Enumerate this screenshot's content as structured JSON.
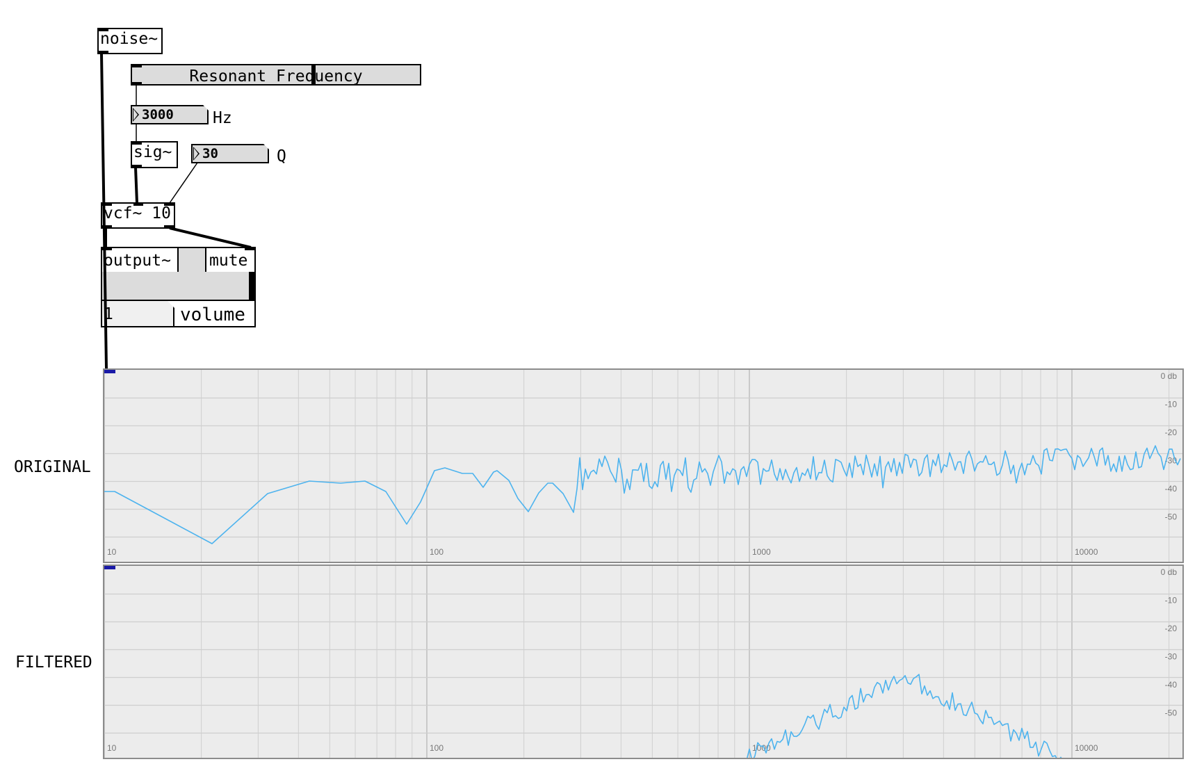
{
  "patch": {
    "noise_obj": "noise~",
    "slider_label": "Resonant Frequency",
    "freq_value": "3000",
    "freq_unit": "Hz",
    "sig_obj": "sig~",
    "q_value": "30",
    "q_label": "Q",
    "vcf_obj": "vcf~ 10",
    "output": {
      "name": "output~",
      "mute": "mute",
      "volume_value": "1",
      "volume_label": "volume"
    }
  },
  "spectra": [
    {
      "label": "ORIGINAL",
      "db_ticks": [
        "0 db",
        "-10",
        "-20",
        "-30",
        "-40",
        "-50"
      ],
      "freq_ticks": [
        "10",
        "100",
        "1000",
        "10000"
      ]
    },
    {
      "label": "FILTERED",
      "db_ticks": [
        "0 db",
        "-10",
        "-20",
        "-30",
        "-40",
        "-50"
      ],
      "freq_ticks": [
        "10",
        "100",
        "1000",
        "10000"
      ]
    }
  ],
  "colors": {
    "trace": "#4db3ee",
    "grid": "#cfcfcf",
    "panel": "#ececec",
    "tick_text": "#777777"
  },
  "state": {
    "resonant_frequency": 3000,
    "q": 30,
    "volume": 1
  }
}
